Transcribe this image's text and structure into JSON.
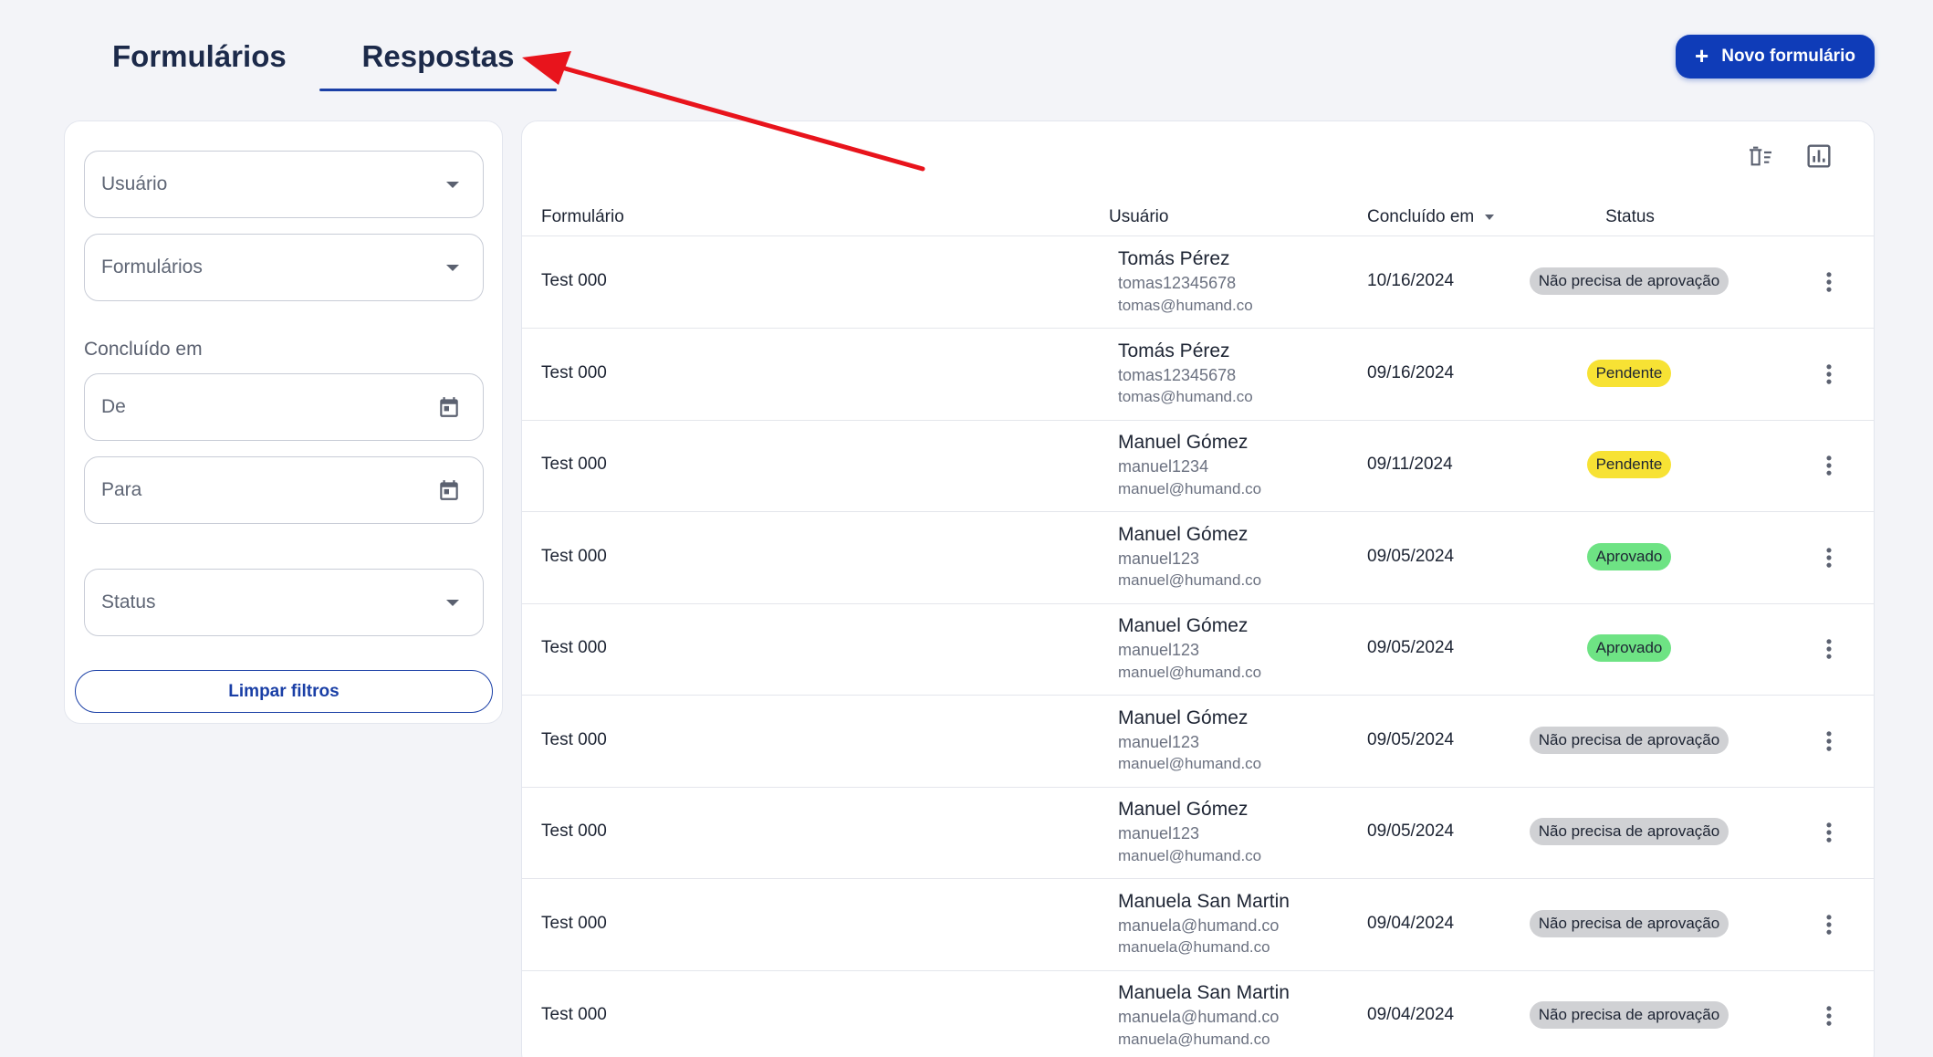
{
  "tabs": [
    {
      "label": "Formulários",
      "active": false
    },
    {
      "label": "Respostas",
      "active": true
    }
  ],
  "header": {
    "new_button_label": "Novo formulário",
    "new_button_icon": "plus-icon"
  },
  "filters": {
    "user_placeholder": "Usuário",
    "forms_placeholder": "Formulários",
    "completed_label": "Concluído em",
    "from_placeholder": "De",
    "to_placeholder": "Para",
    "status_placeholder": "Status",
    "clear_label": "Limpar filtros"
  },
  "table": {
    "toolbar_icons": [
      "delete-columns-icon",
      "bar-chart-icon"
    ],
    "columns": {
      "form": "Formulário",
      "user": "Usuário",
      "completed": "Concluído em",
      "status": "Status"
    },
    "rows": [
      {
        "form": "Test 000",
        "name": "Tomás Pérez",
        "username": "tomas12345678",
        "email": "tomas@humand.co",
        "date": "10/16/2024",
        "status": "Não precisa de aprovação",
        "status_color": "#d0d1d4"
      },
      {
        "form": "Test 000",
        "name": "Tomás Pérez",
        "username": "tomas12345678",
        "email": "tomas@humand.co",
        "date": "09/16/2024",
        "status": "Pendente",
        "status_color": "#f7e234"
      },
      {
        "form": "Test 000",
        "name": "Manuel Gómez",
        "username": "manuel1234",
        "email": "manuel@humand.co",
        "date": "09/11/2024",
        "status": "Pendente",
        "status_color": "#f7e234"
      },
      {
        "form": "Test 000",
        "name": "Manuel Gómez",
        "username": "manuel123",
        "email": "manuel@humand.co",
        "date": "09/05/2024",
        "status": "Aprovado",
        "status_color": "#6ee384"
      },
      {
        "form": "Test 000",
        "name": "Manuel Gómez",
        "username": "manuel123",
        "email": "manuel@humand.co",
        "date": "09/05/2024",
        "status": "Aprovado",
        "status_color": "#6ee384"
      },
      {
        "form": "Test 000",
        "name": "Manuel Gómez",
        "username": "manuel123",
        "email": "manuel@humand.co",
        "date": "09/05/2024",
        "status": "Não precisa de aprovação",
        "status_color": "#d0d1d4"
      },
      {
        "form": "Test 000",
        "name": "Manuel Gómez",
        "username": "manuel123",
        "email": "manuel@humand.co",
        "date": "09/05/2024",
        "status": "Não precisa de aprovação",
        "status_color": "#d0d1d4"
      },
      {
        "form": "Test 000",
        "name": "Manuela San Martin",
        "username": "manuela@humand.co",
        "email": "manuela@humand.co",
        "date": "09/04/2024",
        "status": "Não precisa de aprovação",
        "status_color": "#d0d1d4"
      },
      {
        "form": "Test 000",
        "name": "Manuela San Martin",
        "username": "manuela@humand.co",
        "email": "manuela@humand.co",
        "date": "09/04/2024",
        "status": "Não precisa de aprovação",
        "status_color": "#d0d1d4"
      }
    ]
  },
  "colors": {
    "primary": "#0f3cb8",
    "annotation_arrow": "#e8141c"
  }
}
